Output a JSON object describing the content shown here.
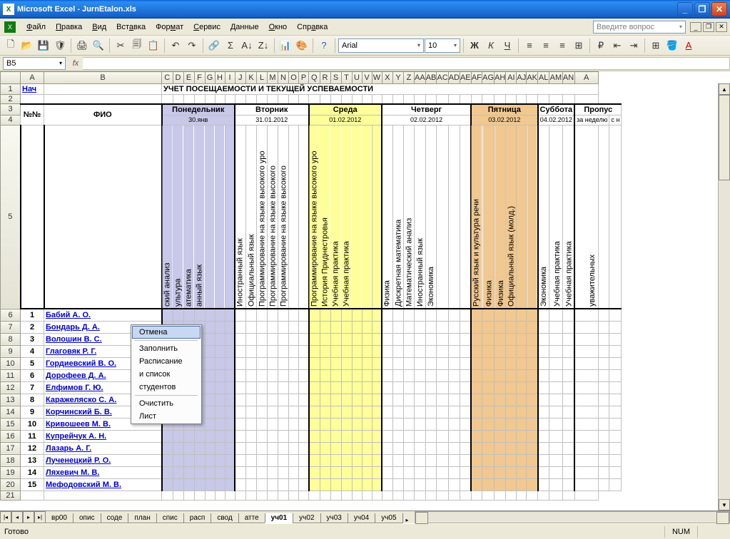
{
  "window": {
    "title": "Microsoft Excel - JurnEtalon.xls"
  },
  "menus": [
    "Файл",
    "Правка",
    "Вид",
    "Вставка",
    "Формат",
    "Сервис",
    "Данные",
    "Окно",
    "Справка"
  ],
  "askbox": "Введите вопрос",
  "toolbar": {
    "font": "Arial",
    "size": "10"
  },
  "namebox": "B5",
  "cols": [
    "A",
    "B",
    "C",
    "D",
    "E",
    "F",
    "G",
    "H",
    "I",
    "J",
    "K",
    "L",
    "M",
    "N",
    "O",
    "P",
    "Q",
    "R",
    "S",
    "T",
    "U",
    "V",
    "W",
    "X",
    "Y",
    "Z",
    "AA",
    "AB",
    "AC",
    "AD",
    "AE",
    "AF",
    "AG",
    "AH",
    "AI",
    "AJ",
    "AK",
    "AL",
    "AM",
    "AN",
    "A"
  ],
  "row_nums": [
    "1",
    "2",
    "3",
    "4",
    "5",
    "6",
    "7",
    "8",
    "9",
    "10",
    "11",
    "12",
    "13",
    "14",
    "15",
    "16",
    "17",
    "18",
    "19",
    "20",
    "21"
  ],
  "a1_link": "Нач",
  "title_text": "УЧЕТ ПОСЕЩАЕМОСТИ И ТЕКУЩЕЙ УСПЕВАЕМОСТИ",
  "fio_label": "ФИО",
  "num_label": "№№",
  "days": {
    "mon": {
      "label": "Понедельник",
      "date": "30.янв"
    },
    "tue": {
      "label": "Вторник",
      "date": "31.01.2012"
    },
    "wed": {
      "label": "Среда",
      "date": "01.02.2012"
    },
    "thu": {
      "label": "Четверг",
      "date": "02.02.2012"
    },
    "fri": {
      "label": "Пятница",
      "date": "03.02.2012"
    },
    "sat": {
      "label": "Суббота",
      "date": "04.02.2012"
    }
  },
  "skip": {
    "label": "Пропус",
    "week": "за неделю",
    "from": "с н"
  },
  "subjects": {
    "mon": [
      "ский  анализ",
      "ультура",
      "атематика",
      "анный язык"
    ],
    "tue": [
      "Иностранный язык",
      "Официальный язык",
      "Программирование на языке высокого уро",
      "Программирование на языке высокого",
      "Программирование на языке высокого"
    ],
    "wed": [
      "Программирование на языке высокого уро",
      "История Приднестровья",
      "Учебная практика",
      "Учебная практика"
    ],
    "thu": [
      "Физика",
      "Дискретная математика",
      "Математический анализ",
      "Иностранный язык",
      "Экономика"
    ],
    "fri": [
      "Русский язык  и культура речи",
      "Физика",
      "Физика",
      "Официальный язык      (молд.)"
    ],
    "sat": [
      "Экономика",
      "Учебная практика",
      "Учебная практика"
    ],
    "skip": [
      "уважительных"
    ]
  },
  "students": [
    {
      "n": "1",
      "name": "Бабий А. О."
    },
    {
      "n": "2",
      "name": "Бондарь Д. А."
    },
    {
      "n": "3",
      "name": "Волошин В. С."
    },
    {
      "n": "4",
      "name": "Глаговяк Р. Г."
    },
    {
      "n": "5",
      "name": "Гордиевский В. О."
    },
    {
      "n": "6",
      "name": "Дорофеев Д. А."
    },
    {
      "n": "7",
      "name": "Елфимов Г. Ю."
    },
    {
      "n": "8",
      "name": "Каражеляско С. А."
    },
    {
      "n": "9",
      "name": "Корчинский Б. В."
    },
    {
      "n": "10",
      "name": "Кривошеев М. В."
    },
    {
      "n": "11",
      "name": "Купрейчук А. Н."
    },
    {
      "n": "12",
      "name": "Лазарь А. Г."
    },
    {
      "n": "13",
      "name": "Лученецкий Р. О."
    },
    {
      "n": "14",
      "name": "Ляхевич М. В."
    },
    {
      "n": "15",
      "name": "Мефодовский М. В."
    }
  ],
  "context_menu": {
    "cancel": "Отмена",
    "fill": "Заполнить",
    "schedule": "Расписание",
    "and_list": "и список",
    "students": "студентов",
    "clear": "Очистить",
    "sheet": "Лист"
  },
  "tabs": [
    "вр00",
    "опис",
    "соде",
    "план",
    "спис",
    "расп",
    "свод",
    "атте",
    "уч01",
    "уч02",
    "уч03",
    "уч04",
    "уч05"
  ],
  "active_tab": "уч01",
  "status": {
    "ready": "Готово",
    "num": "NUM"
  }
}
